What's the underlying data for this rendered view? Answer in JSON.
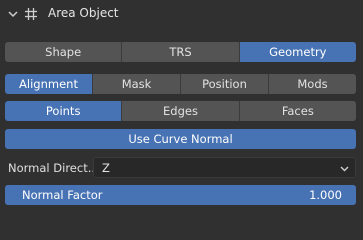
{
  "panel": {
    "title": "Area Object",
    "collapse_icon": "chevron-down-icon",
    "type_icon": "grid-hash-icon"
  },
  "tabs_top": [
    {
      "label": "Shape",
      "active": false
    },
    {
      "label": "TRS",
      "active": false
    },
    {
      "label": "Geometry",
      "active": true
    }
  ],
  "tabs_mode": [
    {
      "label": "Alignment",
      "active": true
    },
    {
      "label": "Mask",
      "active": false
    },
    {
      "label": "Position",
      "active": false
    },
    {
      "label": "Mods",
      "active": false
    }
  ],
  "tabs_element": [
    {
      "label": "Points",
      "active": true
    },
    {
      "label": "Edges",
      "active": false
    },
    {
      "label": "Faces",
      "active": false
    }
  ],
  "use_curve_normal": {
    "label": "Use Curve Normal",
    "enabled": true
  },
  "normal_direction": {
    "label": "Normal Direct...",
    "value": "Z"
  },
  "normal_factor": {
    "label": "Normal Factor",
    "value": "1.000",
    "fill_fraction": 1.0
  },
  "colors": {
    "accent": "#4772b3",
    "panel_bg": "#303030",
    "button_bg": "#545454",
    "field_bg": "#282828"
  }
}
